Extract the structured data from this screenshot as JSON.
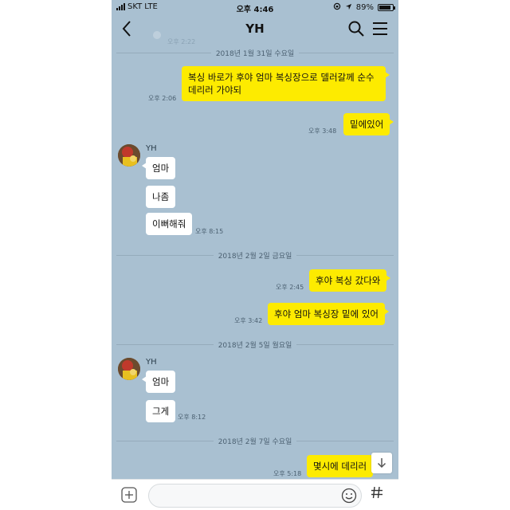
{
  "status_bar": {
    "carrier": "SKT",
    "network": "LTE",
    "time": "오후 4:46",
    "battery_text": "89%",
    "battery_level": 0.89
  },
  "header": {
    "title": "YH"
  },
  "ghost_time": "오후 2:22",
  "dates": {
    "d1": "2018년 1월 31일 수요일",
    "d2": "2018년 2월 2일 금요일",
    "d3": "2018년 2월 5일 월요일",
    "d4": "2018년 2월 7일 수요일"
  },
  "messages": {
    "m1_line1": "복싱 바로가 후야 엄마 복싱장으로 델러갈께 순수",
    "m1_line2": "데리러 가야되",
    "m1_time": "오후 2:06",
    "m2": "밑에있어",
    "m2_time": "오후 3:48",
    "sender1": "YH",
    "o1": "엄마",
    "o2": "나좀",
    "o3": "이뻐해줘",
    "o3_time": "오후 8:15",
    "m3": "후야 복싱 갔다와",
    "m3_time": "오후 2:45",
    "m4": "후야 엄마 복싱장 밑에 있어",
    "m4_time": "오후 3:42",
    "sender2": "YH",
    "o4": "엄마",
    "o5": "그게",
    "o5_time": "오후 8:12",
    "m5": "몇시에 데리러",
    "m5_time": "오후 5:18"
  },
  "input": {
    "placeholder": ""
  },
  "colors": {
    "chat_bg": "#a9c0d1",
    "my_bubble": "#fdeb00",
    "other_bubble": "#ffffff"
  },
  "icons": [
    "back-chevron-icon",
    "search-icon",
    "menu-icon",
    "plus-icon",
    "emoji-icon",
    "hash-icon",
    "arrow-down-icon"
  ]
}
